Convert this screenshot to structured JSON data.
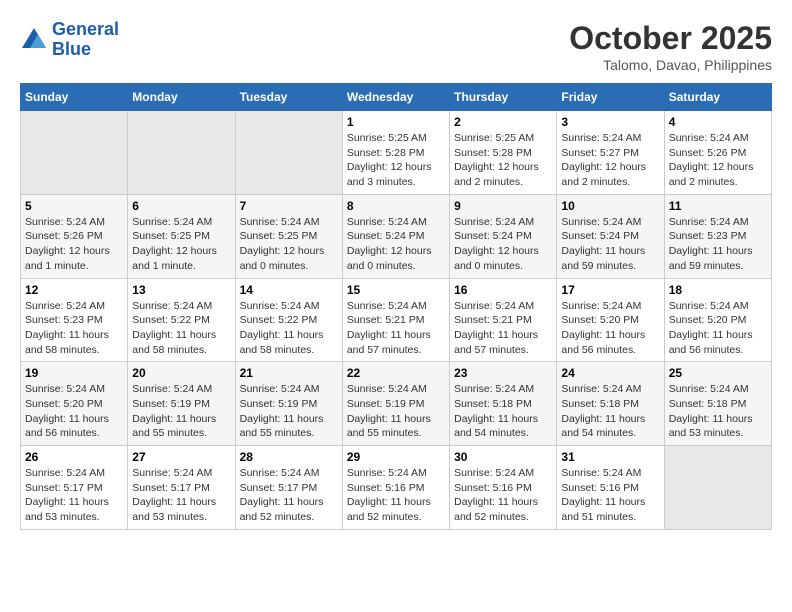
{
  "header": {
    "logo_line1": "General",
    "logo_line2": "Blue",
    "month": "October 2025",
    "location": "Talomo, Davao, Philippines"
  },
  "weekdays": [
    "Sunday",
    "Monday",
    "Tuesday",
    "Wednesday",
    "Thursday",
    "Friday",
    "Saturday"
  ],
  "weeks": [
    [
      {
        "day": "",
        "info": ""
      },
      {
        "day": "",
        "info": ""
      },
      {
        "day": "",
        "info": ""
      },
      {
        "day": "1",
        "info": "Sunrise: 5:25 AM\nSunset: 5:28 PM\nDaylight: 12 hours and 3 minutes."
      },
      {
        "day": "2",
        "info": "Sunrise: 5:25 AM\nSunset: 5:28 PM\nDaylight: 12 hours and 2 minutes."
      },
      {
        "day": "3",
        "info": "Sunrise: 5:24 AM\nSunset: 5:27 PM\nDaylight: 12 hours and 2 minutes."
      },
      {
        "day": "4",
        "info": "Sunrise: 5:24 AM\nSunset: 5:26 PM\nDaylight: 12 hours and 2 minutes."
      }
    ],
    [
      {
        "day": "5",
        "info": "Sunrise: 5:24 AM\nSunset: 5:26 PM\nDaylight: 12 hours and 1 minute."
      },
      {
        "day": "6",
        "info": "Sunrise: 5:24 AM\nSunset: 5:25 PM\nDaylight: 12 hours and 1 minute."
      },
      {
        "day": "7",
        "info": "Sunrise: 5:24 AM\nSunset: 5:25 PM\nDaylight: 12 hours and 0 minutes."
      },
      {
        "day": "8",
        "info": "Sunrise: 5:24 AM\nSunset: 5:24 PM\nDaylight: 12 hours and 0 minutes."
      },
      {
        "day": "9",
        "info": "Sunrise: 5:24 AM\nSunset: 5:24 PM\nDaylight: 12 hours and 0 minutes."
      },
      {
        "day": "10",
        "info": "Sunrise: 5:24 AM\nSunset: 5:24 PM\nDaylight: 11 hours and 59 minutes."
      },
      {
        "day": "11",
        "info": "Sunrise: 5:24 AM\nSunset: 5:23 PM\nDaylight: 11 hours and 59 minutes."
      }
    ],
    [
      {
        "day": "12",
        "info": "Sunrise: 5:24 AM\nSunset: 5:23 PM\nDaylight: 11 hours and 58 minutes."
      },
      {
        "day": "13",
        "info": "Sunrise: 5:24 AM\nSunset: 5:22 PM\nDaylight: 11 hours and 58 minutes."
      },
      {
        "day": "14",
        "info": "Sunrise: 5:24 AM\nSunset: 5:22 PM\nDaylight: 11 hours and 58 minutes."
      },
      {
        "day": "15",
        "info": "Sunrise: 5:24 AM\nSunset: 5:21 PM\nDaylight: 11 hours and 57 minutes."
      },
      {
        "day": "16",
        "info": "Sunrise: 5:24 AM\nSunset: 5:21 PM\nDaylight: 11 hours and 57 minutes."
      },
      {
        "day": "17",
        "info": "Sunrise: 5:24 AM\nSunset: 5:20 PM\nDaylight: 11 hours and 56 minutes."
      },
      {
        "day": "18",
        "info": "Sunrise: 5:24 AM\nSunset: 5:20 PM\nDaylight: 11 hours and 56 minutes."
      }
    ],
    [
      {
        "day": "19",
        "info": "Sunrise: 5:24 AM\nSunset: 5:20 PM\nDaylight: 11 hours and 56 minutes."
      },
      {
        "day": "20",
        "info": "Sunrise: 5:24 AM\nSunset: 5:19 PM\nDaylight: 11 hours and 55 minutes."
      },
      {
        "day": "21",
        "info": "Sunrise: 5:24 AM\nSunset: 5:19 PM\nDaylight: 11 hours and 55 minutes."
      },
      {
        "day": "22",
        "info": "Sunrise: 5:24 AM\nSunset: 5:19 PM\nDaylight: 11 hours and 55 minutes."
      },
      {
        "day": "23",
        "info": "Sunrise: 5:24 AM\nSunset: 5:18 PM\nDaylight: 11 hours and 54 minutes."
      },
      {
        "day": "24",
        "info": "Sunrise: 5:24 AM\nSunset: 5:18 PM\nDaylight: 11 hours and 54 minutes."
      },
      {
        "day": "25",
        "info": "Sunrise: 5:24 AM\nSunset: 5:18 PM\nDaylight: 11 hours and 53 minutes."
      }
    ],
    [
      {
        "day": "26",
        "info": "Sunrise: 5:24 AM\nSunset: 5:17 PM\nDaylight: 11 hours and 53 minutes."
      },
      {
        "day": "27",
        "info": "Sunrise: 5:24 AM\nSunset: 5:17 PM\nDaylight: 11 hours and 53 minutes."
      },
      {
        "day": "28",
        "info": "Sunrise: 5:24 AM\nSunset: 5:17 PM\nDaylight: 11 hours and 52 minutes."
      },
      {
        "day": "29",
        "info": "Sunrise: 5:24 AM\nSunset: 5:16 PM\nDaylight: 11 hours and 52 minutes."
      },
      {
        "day": "30",
        "info": "Sunrise: 5:24 AM\nSunset: 5:16 PM\nDaylight: 11 hours and 52 minutes."
      },
      {
        "day": "31",
        "info": "Sunrise: 5:24 AM\nSunset: 5:16 PM\nDaylight: 11 hours and 51 minutes."
      },
      {
        "day": "",
        "info": ""
      }
    ]
  ]
}
